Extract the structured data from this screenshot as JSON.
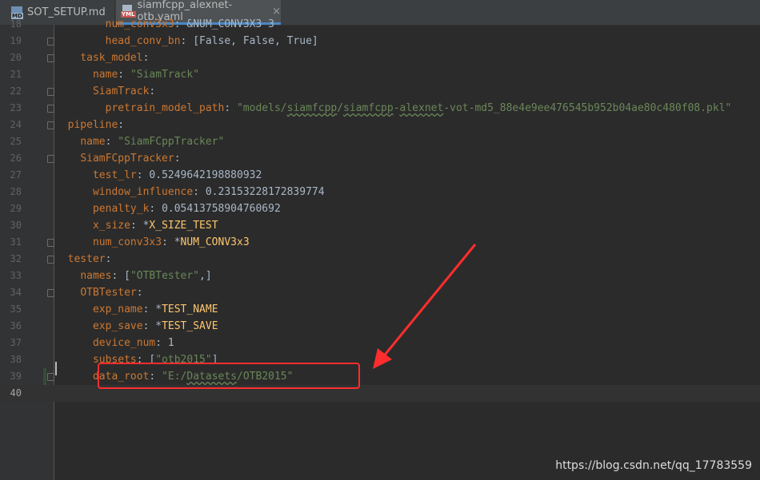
{
  "tabs": [
    {
      "label": "SOT_SETUP.md",
      "icon": "markdown-file-icon",
      "active": false
    },
    {
      "label": "siamfcpp_alexnet-otb.yaml",
      "icon": "yaml-file-icon",
      "active": true
    }
  ],
  "tab_close": "×",
  "lines": [
    {
      "num": "18",
      "segments": [
        {
          "t": "        ",
          "c": "n"
        },
        {
          "t": "num_conv3x3",
          "c": "k"
        },
        {
          "t": ": ",
          "c": "n"
        },
        {
          "t": "&NUM_CONV3X3 3",
          "c": "n"
        }
      ]
    },
    {
      "num": "19",
      "segments": [
        {
          "t": "        ",
          "c": "n"
        },
        {
          "t": "head_conv_bn",
          "c": "k"
        },
        {
          "t": ": [False, False, True]",
          "c": "n"
        }
      ]
    },
    {
      "num": "20",
      "segments": [
        {
          "t": "    ",
          "c": "n"
        },
        {
          "t": "task_model",
          "c": "k"
        },
        {
          "t": ":",
          "c": "n"
        }
      ]
    },
    {
      "num": "21",
      "segments": [
        {
          "t": "      ",
          "c": "n"
        },
        {
          "t": "name",
          "c": "k"
        },
        {
          "t": ": ",
          "c": "n"
        },
        {
          "t": "\"SiamTrack\"",
          "c": "s"
        }
      ]
    },
    {
      "num": "22",
      "segments": [
        {
          "t": "      ",
          "c": "n"
        },
        {
          "t": "SiamTrack",
          "c": "k"
        },
        {
          "t": ":",
          "c": "n"
        }
      ]
    },
    {
      "num": "23",
      "segments": [
        {
          "t": "        ",
          "c": "n"
        },
        {
          "t": "pretrain_model_path",
          "c": "k"
        },
        {
          "t": ": ",
          "c": "n"
        },
        {
          "t": "\"models/",
          "c": "s"
        },
        {
          "t": "siamfcpp",
          "c": "s u"
        },
        {
          "t": "/",
          "c": "s"
        },
        {
          "t": "siamfcpp",
          "c": "s u"
        },
        {
          "t": "-",
          "c": "s"
        },
        {
          "t": "alexnet",
          "c": "s u"
        },
        {
          "t": "-vot-md5_88e4e9ee476545b952b04ae80c480f08.pkl\"",
          "c": "s"
        }
      ]
    },
    {
      "num": "24",
      "segments": [
        {
          "t": "  ",
          "c": "n"
        },
        {
          "t": "pipeline",
          "c": "k"
        },
        {
          "t": ":",
          "c": "n"
        }
      ]
    },
    {
      "num": "25",
      "segments": [
        {
          "t": "    ",
          "c": "n"
        },
        {
          "t": "name",
          "c": "k"
        },
        {
          "t": ": ",
          "c": "n"
        },
        {
          "t": "\"SiamFCppTracker\"",
          "c": "s"
        }
      ]
    },
    {
      "num": "26",
      "segments": [
        {
          "t": "    ",
          "c": "n"
        },
        {
          "t": "SiamFCppTracker",
          "c": "k"
        },
        {
          "t": ":",
          "c": "n"
        }
      ]
    },
    {
      "num": "27",
      "segments": [
        {
          "t": "      ",
          "c": "n"
        },
        {
          "t": "test_lr",
          "c": "k"
        },
        {
          "t": ": 0.5249642198880932",
          "c": "n"
        }
      ]
    },
    {
      "num": "28",
      "segments": [
        {
          "t": "      ",
          "c": "n"
        },
        {
          "t": "window_influence",
          "c": "k"
        },
        {
          "t": ": 0.23153228172839774",
          "c": "n"
        }
      ]
    },
    {
      "num": "29",
      "segments": [
        {
          "t": "      ",
          "c": "n"
        },
        {
          "t": "penalty_k",
          "c": "k"
        },
        {
          "t": ": 0.05413758904760692",
          "c": "n"
        }
      ]
    },
    {
      "num": "30",
      "segments": [
        {
          "t": "      ",
          "c": "n"
        },
        {
          "t": "x_size",
          "c": "k"
        },
        {
          "t": ": *",
          "c": "n"
        },
        {
          "t": "X_SIZE_TEST",
          "c": "a"
        }
      ]
    },
    {
      "num": "31",
      "segments": [
        {
          "t": "      ",
          "c": "n"
        },
        {
          "t": "num_conv3x3",
          "c": "k"
        },
        {
          "t": ": *",
          "c": "n"
        },
        {
          "t": "NUM_CONV3x3",
          "c": "a"
        }
      ]
    },
    {
      "num": "32",
      "segments": [
        {
          "t": "  ",
          "c": "n"
        },
        {
          "t": "tester",
          "c": "k"
        },
        {
          "t": ":",
          "c": "n"
        }
      ]
    },
    {
      "num": "33",
      "segments": [
        {
          "t": "    ",
          "c": "n"
        },
        {
          "t": "names",
          "c": "k"
        },
        {
          "t": ": [",
          "c": "n"
        },
        {
          "t": "\"OTBTester\"",
          "c": "s"
        },
        {
          "t": ",]",
          "c": "n"
        }
      ]
    },
    {
      "num": "34",
      "segments": [
        {
          "t": "    ",
          "c": "n"
        },
        {
          "t": "OTBTester",
          "c": "k"
        },
        {
          "t": ":",
          "c": "n"
        }
      ]
    },
    {
      "num": "35",
      "segments": [
        {
          "t": "      ",
          "c": "n"
        },
        {
          "t": "exp_name",
          "c": "k"
        },
        {
          "t": ": *",
          "c": "n"
        },
        {
          "t": "TEST_NAME",
          "c": "a"
        }
      ]
    },
    {
      "num": "36",
      "segments": [
        {
          "t": "      ",
          "c": "n"
        },
        {
          "t": "exp_save",
          "c": "k"
        },
        {
          "t": ": *",
          "c": "n"
        },
        {
          "t": "TEST_SAVE",
          "c": "a"
        }
      ]
    },
    {
      "num": "37",
      "segments": [
        {
          "t": "      ",
          "c": "n"
        },
        {
          "t": "device_num",
          "c": "k"
        },
        {
          "t": ": 1",
          "c": "n"
        }
      ]
    },
    {
      "num": "38",
      "segments": [
        {
          "t": "      ",
          "c": "n"
        },
        {
          "t": "subsets",
          "c": "k"
        },
        {
          "t": ": [",
          "c": "n"
        },
        {
          "t": "\"otb2015\"",
          "c": "s"
        },
        {
          "t": "]",
          "c": "n"
        }
      ]
    },
    {
      "num": "39",
      "segments": [
        {
          "t": "      ",
          "c": "n"
        },
        {
          "t": "data_root",
          "c": "k"
        },
        {
          "t": ": ",
          "c": "n"
        },
        {
          "t": "\"E:/",
          "c": "s"
        },
        {
          "t": "Datasets",
          "c": "s u"
        },
        {
          "t": "/OTB2015\"",
          "c": "s"
        }
      ]
    },
    {
      "num": "40",
      "segments": []
    }
  ],
  "colors": {
    "keyword": "#cc7832",
    "string": "#6a8759",
    "plain": "#a9b7c6",
    "anchor": "#ffc66d",
    "annotation": "#ff2d2d"
  },
  "watermark": "https://blog.csdn.net/qq_17783559"
}
